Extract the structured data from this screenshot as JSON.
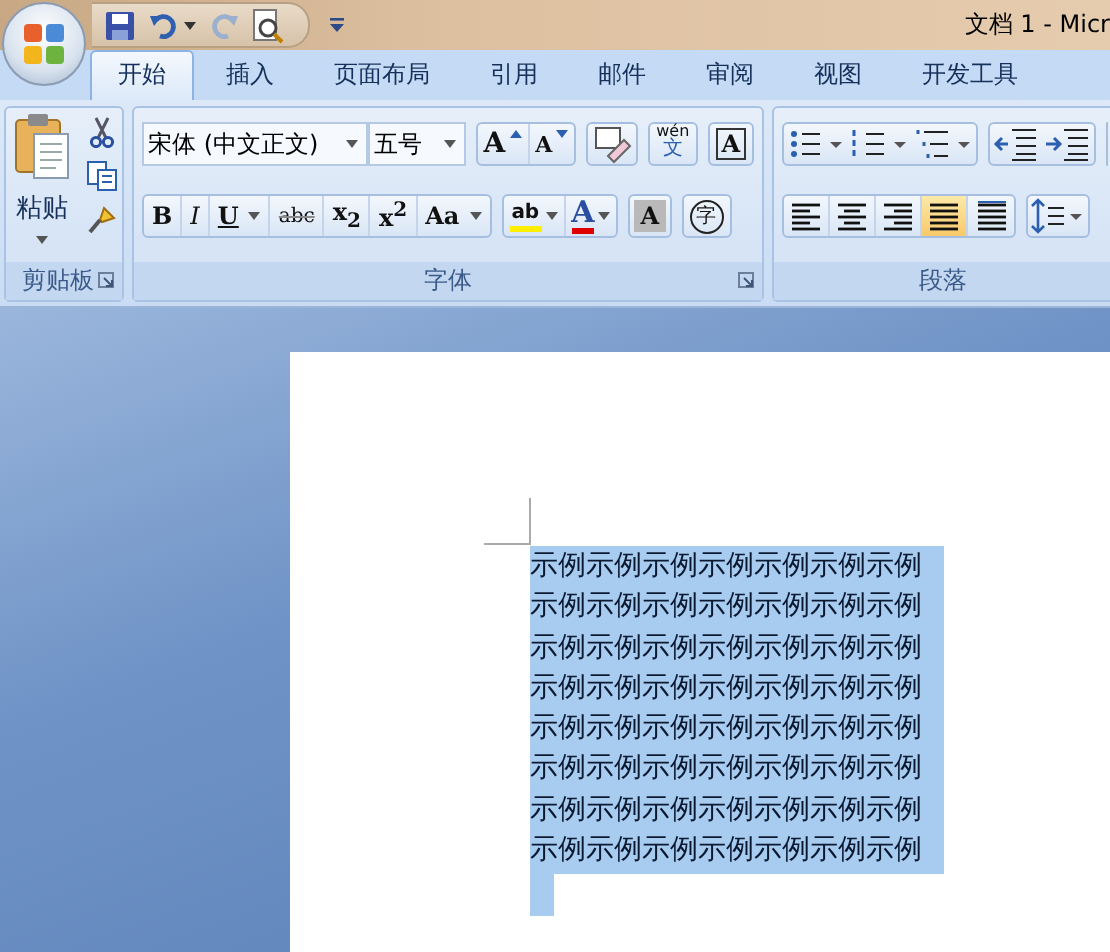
{
  "title_bar": {
    "title": "文档 1 - Micr"
  },
  "tabs": [
    {
      "label": "开始",
      "selected": true
    },
    {
      "label": "插入",
      "selected": false
    },
    {
      "label": "页面布局",
      "selected": false
    },
    {
      "label": "引用",
      "selected": false
    },
    {
      "label": "邮件",
      "selected": false
    },
    {
      "label": "审阅",
      "selected": false
    },
    {
      "label": "视图",
      "selected": false
    },
    {
      "label": "开发工具",
      "selected": false
    }
  ],
  "clipboard": {
    "paste_label": "粘贴",
    "group_label": "剪贴板"
  },
  "font": {
    "font_name": "宋体 (中文正文)",
    "font_size": "五号",
    "group_label": "字体",
    "format_buttons": [
      {
        "label": "B",
        "kind": "bold",
        "dropdown": false
      },
      {
        "label": "I",
        "kind": "italic",
        "dropdown": false
      },
      {
        "label": "U",
        "kind": "underline",
        "dropdown": true
      },
      {
        "label": "abc",
        "kind": "strike",
        "dropdown": false
      },
      {
        "label": "x$_{2}$",
        "kind": "plain",
        "dropdown": false
      },
      {
        "label": "x$^{2}$",
        "kind": "plain",
        "dropdown": false
      },
      {
        "label": "Aa",
        "kind": "plain",
        "dropdown": true
      }
    ],
    "grow_label": "A",
    "shrink_label": "A",
    "phonetic_top": "wén",
    "phonetic_bottom": "文",
    "border_label": "A",
    "highlight_label": "ab",
    "color_label": "A",
    "shading_label": "A",
    "enclose_label": "字"
  },
  "paragraph": {
    "group_label": "段落",
    "align_buttons": [
      {
        "kind": "left",
        "selected": false
      },
      {
        "kind": "center",
        "selected": false
      },
      {
        "kind": "right",
        "selected": false
      },
      {
        "kind": "justify",
        "selected": true
      },
      {
        "kind": "distributed",
        "selected": false
      }
    ]
  },
  "document": {
    "selected": true,
    "lines": [
      "示例示例示例示例示例示例示例",
      "示例示例示例示例示例示例示例",
      "示例示例示例示例示例示例示例",
      "示例示例示例示例示例示例示例",
      "示例示例示例示例示例示例示例",
      "示例示例示例示例示例示例示例",
      "示例示例示例示例示例示例示例",
      "示例示例示例示例示例示例示例"
    ]
  }
}
